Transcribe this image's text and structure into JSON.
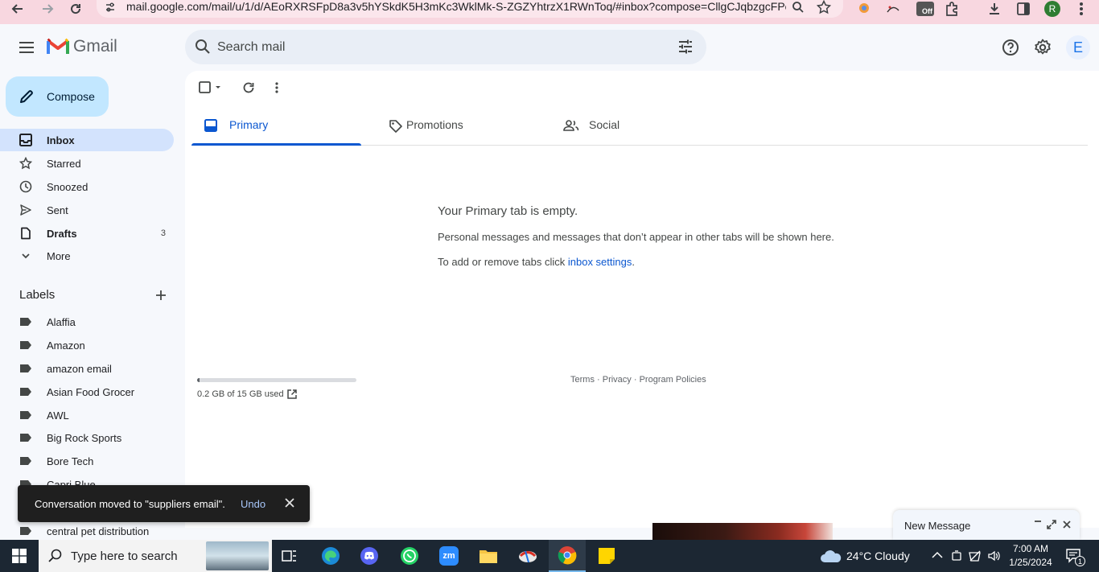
{
  "browser": {
    "url": "mail.google.com/mail/u/1/d/AEoRXRSFpD8a3v5hYSkdK5H3mKc3WklMk-S-ZGZYhtrzX1RWnToq/#inbox?compose=CllgCJqbzgcFPc...",
    "extension_off_label": "Off",
    "profile_letter": "R"
  },
  "header": {
    "app_name": "Gmail",
    "search_placeholder": "Search mail",
    "avatar_letter": "E"
  },
  "sidebar": {
    "compose_label": "Compose",
    "nav": [
      {
        "label": "Inbox",
        "count": "",
        "icon": "inbox-icon"
      },
      {
        "label": "Starred",
        "count": "",
        "icon": "star-icon"
      },
      {
        "label": "Snoozed",
        "count": "",
        "icon": "clock-icon"
      },
      {
        "label": "Sent",
        "count": "",
        "icon": "send-icon"
      },
      {
        "label": "Drafts",
        "count": "3",
        "icon": "draft-icon"
      },
      {
        "label": "More",
        "count": "",
        "icon": "chevron-down-icon"
      }
    ],
    "labels_header": "Labels",
    "labels": [
      "Alaffia",
      "Amazon",
      "amazon email",
      "Asian Food Grocer",
      "AWL",
      "Big Rock Sports",
      "Bore Tech",
      "Capri Blue",
      "central pet distribution"
    ]
  },
  "tabs": [
    {
      "label": "Primary"
    },
    {
      "label": "Promotions"
    },
    {
      "label": "Social"
    }
  ],
  "empty_state": {
    "title": "Your Primary tab is empty.",
    "description": "Personal messages and messages that don’t appear in other tabs will be shown here.",
    "settings_prefix": "To add or remove tabs click ",
    "settings_link": "inbox settings",
    "settings_suffix": "."
  },
  "storage": {
    "text": "0.2 GB of 15 GB used",
    "fraction_used": 0.013
  },
  "footer": {
    "terms": "Terms",
    "privacy": "Privacy",
    "policies": "Program Policies",
    "separator": " · "
  },
  "snackbar": {
    "message": "Conversation moved to \"suppliers email\".",
    "undo_label": "Undo"
  },
  "new_message": {
    "title": "New Message"
  },
  "taskbar": {
    "search_placeholder": "Type here to search",
    "weather": "24°C  Cloudy",
    "time": "7:00 AM",
    "date": "1/25/2024",
    "notification_count": "1",
    "zoom_label": "zm"
  },
  "colors": {
    "accent": "#0b57d0",
    "compose_bg": "#c2e7ff",
    "active_nav_bg": "#d3e3fd",
    "chrome_bar": "#f8d7e0"
  }
}
